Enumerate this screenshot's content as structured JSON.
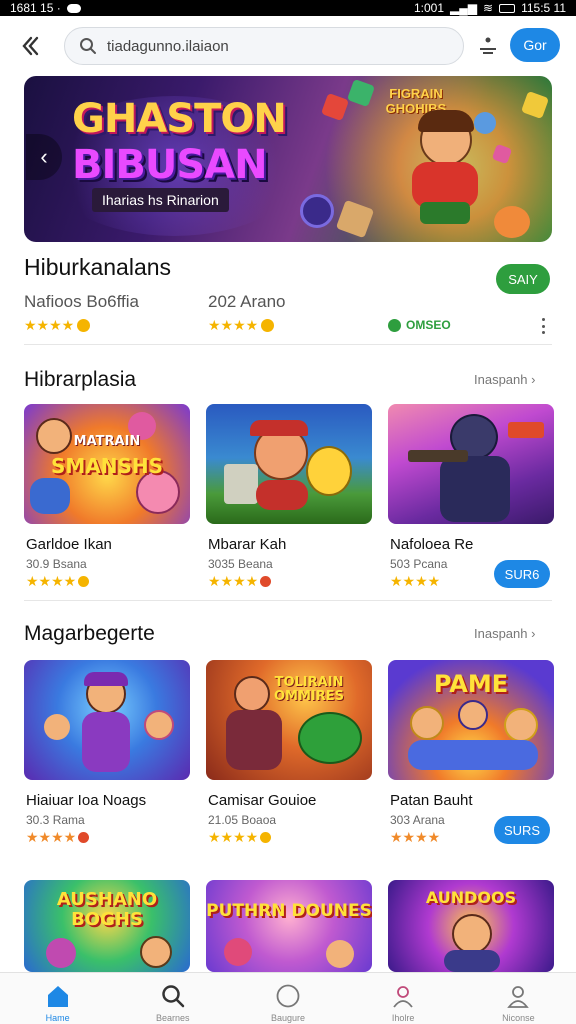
{
  "status_bar": {
    "time": "1681 15 ·",
    "right": "1:001",
    "battery": "115:5 11"
  },
  "topbar": {
    "search_value": "tiadagunno.ilaiaon",
    "go_label": "Gor"
  },
  "banner": {
    "title_line1": "GHASTON",
    "title_line2": "BIBUSAN",
    "subtitle": "Iharias hs Rinarion",
    "badge": "FIGRAIN GHOHIBS"
  },
  "featured": {
    "title": "Hiburkanalans",
    "action_label": "SAIY",
    "meta_left": "Nafioos Bo6ffia",
    "meta_mid": "202 Arano",
    "status": "OMSEO"
  },
  "section1": {
    "title": "Hibrarplasia",
    "see_more": "Inaspanh ›",
    "cards": [
      {
        "name": "Garldoe Ikan",
        "meta": "30.9 Bsana",
        "thumb_text": "SMANSHS",
        "thumb_text2": "MATRAIN"
      },
      {
        "name": "Mbarar Kah",
        "meta": "3035 Beana"
      },
      {
        "name": "Nafoloea Re",
        "meta": "503 Pcana",
        "button": "SUR6"
      }
    ]
  },
  "section2": {
    "title": "Magarbegerte",
    "see_more": "Inaspanh ›",
    "cards": [
      {
        "name": "Hiaiuar Ioa Noags",
        "meta": "30.3 Rama"
      },
      {
        "name": "Camisar Gouioe",
        "meta": "21.05 Boaoa",
        "thumb_text": "TOLIRAIN OMMIRES"
      },
      {
        "name": "Patan Bauht",
        "meta": "303 Arana",
        "button": "SURS",
        "thumb_text": "PAME"
      }
    ]
  },
  "section3": {
    "cards": [
      {
        "thumb_text": "AUSHANO BOGHS"
      },
      {
        "thumb_text": "PUTHRN DOUNES"
      },
      {
        "thumb_text": "AUNDOOS"
      }
    ]
  },
  "bottom_nav": [
    {
      "label": "Hame",
      "icon": "home-icon"
    },
    {
      "label": "Bearnes",
      "icon": "search-icon"
    },
    {
      "label": "Baugure",
      "icon": "circle-icon"
    },
    {
      "label": "Iholre",
      "icon": "pin-icon"
    },
    {
      "label": "Niconse",
      "icon": "person-icon"
    }
  ],
  "colors": {
    "accent": "#1e88e5",
    "green": "#2e9e3e",
    "star": "#f5b400"
  }
}
